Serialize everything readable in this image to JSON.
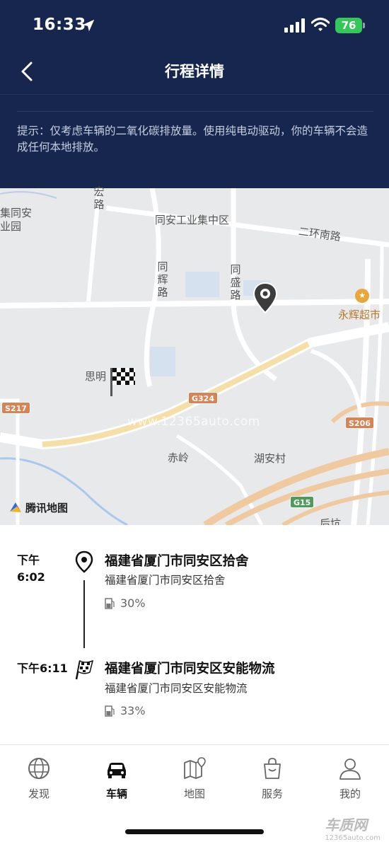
{
  "status_bar": {
    "time": "16:33",
    "battery": "76"
  },
  "header": {
    "title": "行程详情",
    "hint": "提示：仅考虑车辆的二氧化碳排放量。使用纯电动驱动，你的车辆不会造成任何本地排放。"
  },
  "map": {
    "labels": {
      "tongan_industrial": "同安工业集中区",
      "erhuan_south": "二环南路",
      "yonghui": "永辉超市",
      "siming": "思明",
      "chiling": "赤岭",
      "huan_village": "湖安村",
      "hong_road": "宏路",
      "tonghui_road": "同辉路",
      "tongsheng_road": "同盛路",
      "tongan_park_1": "集同安",
      "tongan_park_2": "业园",
      "houkeng": "后坑",
      "g324": "G324",
      "s206": "S206",
      "s217": "S217",
      "g15": "G15",
      "watermark": "www.12365auto.com"
    },
    "brand": "腾讯地图"
  },
  "trip": {
    "start": {
      "time_line1": "下午",
      "time_line2": "6:02",
      "name": "福建省厦门市同安区拾舍",
      "address": "福建省厦门市同安区拾舍",
      "battery": "30%"
    },
    "end": {
      "time": "下午6:11",
      "name": "福建省厦门市同安区安能物流",
      "address": "福建省厦门市同安区安能物流",
      "battery": "33%"
    }
  },
  "tabbar": {
    "items": [
      {
        "label": "发现",
        "icon": "globe-icon"
      },
      {
        "label": "车辆",
        "icon": "car-icon",
        "active": true
      },
      {
        "label": "地图",
        "icon": "map-icon"
      },
      {
        "label": "服务",
        "icon": "shopping-bag-icon"
      },
      {
        "label": "我的",
        "icon": "person-icon"
      }
    ]
  },
  "watermark": {
    "brand": "车质网",
    "url": "12365auto.com"
  },
  "colors": {
    "header_bg": "#16264f",
    "battery_green": "#34c759",
    "road_highlight": "#f6dfa6"
  }
}
